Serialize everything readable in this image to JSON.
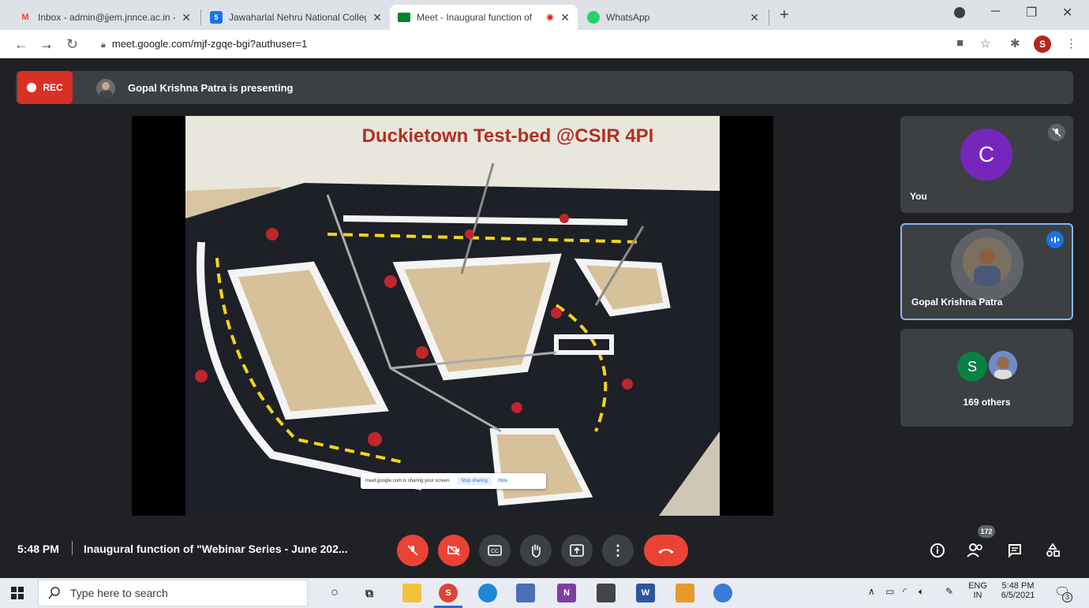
{
  "browser": {
    "tabs": [
      {
        "title": "Inbox - admin@jjem.jnnce.ac.in -",
        "favicon": "gmail-icon"
      },
      {
        "title": "Jawaharlal Nehru National Colleg",
        "favicon": "calendar-icon"
      },
      {
        "title": "Meet - Inaugural function of",
        "favicon": "meet-icon",
        "active": true
      },
      {
        "title": "WhatsApp",
        "favicon": "whatsapp-icon"
      }
    ],
    "url": "meet.google.com/mjf-zgqe-bgi?authuser=1",
    "profile_initial": "S"
  },
  "meet": {
    "rec_label": "REC",
    "presenting_text": "Gopal Krishna Patra is presenting",
    "slide_title": "Duckietown Test-bed @CSIR 4PI",
    "share_notice": {
      "text": "meet.google.com is sharing your screen.",
      "stop_label": "Stop sharing",
      "hide_label": "Hide"
    },
    "participants": {
      "you": {
        "initial": "C",
        "name": "You"
      },
      "presenter": {
        "name": "Gopal Krishna Patra"
      },
      "others": {
        "initial": "S",
        "label": "169 others"
      }
    },
    "bottom_bar": {
      "time": "5:48 PM",
      "meeting_title": "Inaugural function of \"Webinar Series - June 202...",
      "participant_count": "172"
    },
    "colors": {
      "accent_red": "#ea4335",
      "tile": "#3c4043",
      "active_outline": "#8ab4f8"
    }
  },
  "taskbar": {
    "search_placeholder": "Type here to search",
    "language": "ENG",
    "region": "IN",
    "time": "5:48 PM",
    "date": "6/5/2021",
    "notification_count": "3"
  }
}
